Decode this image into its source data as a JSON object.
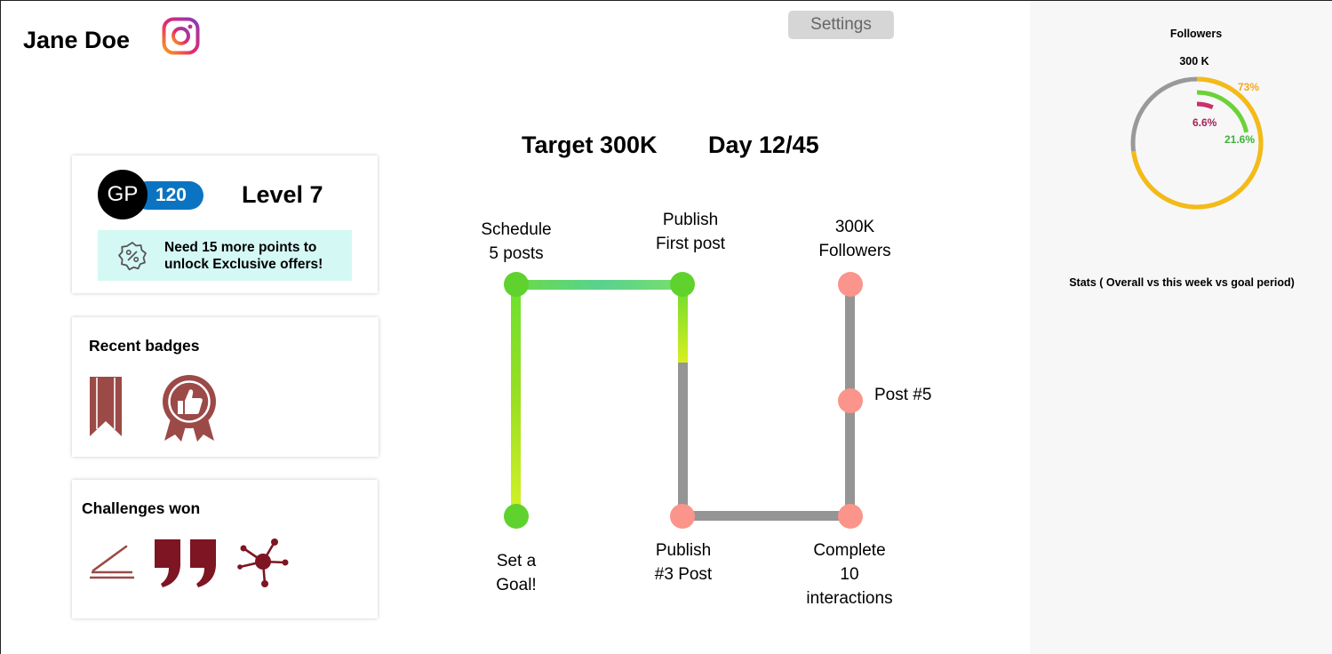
{
  "header": {
    "user_name": "Jane Doe",
    "settings_label": "Settings"
  },
  "profile": {
    "avatar_initials": "GP",
    "points": "120",
    "level": "Level 7",
    "offer_line1": "Need 15 more points to",
    "offer_line2": "unlock Exclusive offers!"
  },
  "badges": {
    "title": "Recent badges",
    "icons": [
      "bookmark-ribbon-icon",
      "thumbs-up-rosette-icon"
    ]
  },
  "challenges": {
    "title": "Challenges  won",
    "icons": [
      "writing-icon",
      "quote-marks-icon",
      "network-icon"
    ]
  },
  "goal": {
    "target": "Target 300K",
    "day": "Day 12/45",
    "progress_fraction": 0.267
  },
  "roadmap": {
    "steps": [
      {
        "line1": "Set a",
        "line2": "Goal!",
        "done": true
      },
      {
        "line1": "Schedule",
        "line2": "5 posts",
        "done": true
      },
      {
        "line1": "Publish",
        "line2": "First post",
        "done": true
      },
      {
        "line1": "Publish",
        "line2": "#3 Post",
        "done": false
      },
      {
        "line1": "Complete",
        "line2": "10",
        "line3": "interactions",
        "done": false
      },
      {
        "line1": "Post #5",
        "done": false
      },
      {
        "line1": "300K",
        "line2": "Followers",
        "done": false
      }
    ]
  },
  "followers_panel": {
    "title": "Followers",
    "total": "300 K",
    "ring_overall_pct": "73%",
    "ring_week_pct": "21.6%",
    "ring_goal_pct": "6.6%",
    "ring_overall_value": 73,
    "ring_week_value": 21.6,
    "ring_goal_value": 6.6,
    "caption": "Stats ( Overall vs this week vs goal period)",
    "colors": {
      "overall": "#f5bb14",
      "week": "#6bd239",
      "goal": "#cc2f6c",
      "track": "#999999"
    }
  }
}
